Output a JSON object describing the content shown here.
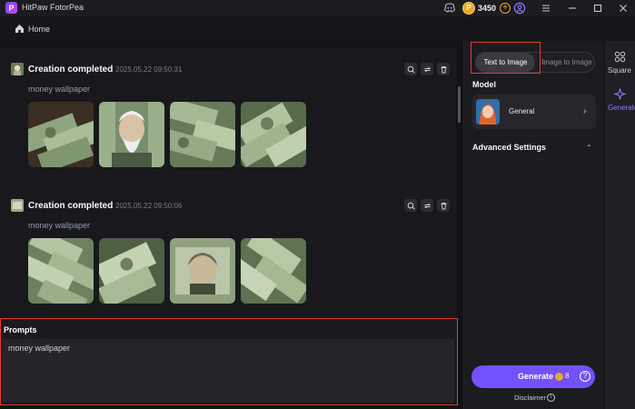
{
  "titlebar": {
    "app_title": "HitPaw FotorPea",
    "coins": "3450",
    "icons": [
      "discord-icon",
      "coin-icon",
      "add-coins-icon",
      "account-icon",
      "menu-icon",
      "minimize-icon",
      "maximize-icon",
      "close-icon"
    ]
  },
  "nav": {
    "home_label": "Home"
  },
  "feed": {
    "cards": [
      {
        "title": "Creation completed",
        "time": "2025.05.22   09:50:31",
        "prompt": "money wallpaper"
      },
      {
        "title": "Creation completed",
        "time": "2025.05.22   09:50:06",
        "prompt": "money wallpaper"
      }
    ]
  },
  "prompts": {
    "title": "Prompts",
    "value": "money wallpaper"
  },
  "panel": {
    "tab_text_to_image": "Text to Image",
    "tab_image_to_image": "Image to Image",
    "model_label": "Model",
    "model_name": "General",
    "advanced_label": "Advanced Settings",
    "generate_label": "Generate",
    "generate_cost": "8",
    "disclaimer": "Disclaimer"
  },
  "rail": {
    "square_label": "Square",
    "generate_label": "Generate"
  },
  "colors": {
    "accent": "#7351ff",
    "highlight": "#e53a31",
    "coin": "#e8a92a"
  }
}
